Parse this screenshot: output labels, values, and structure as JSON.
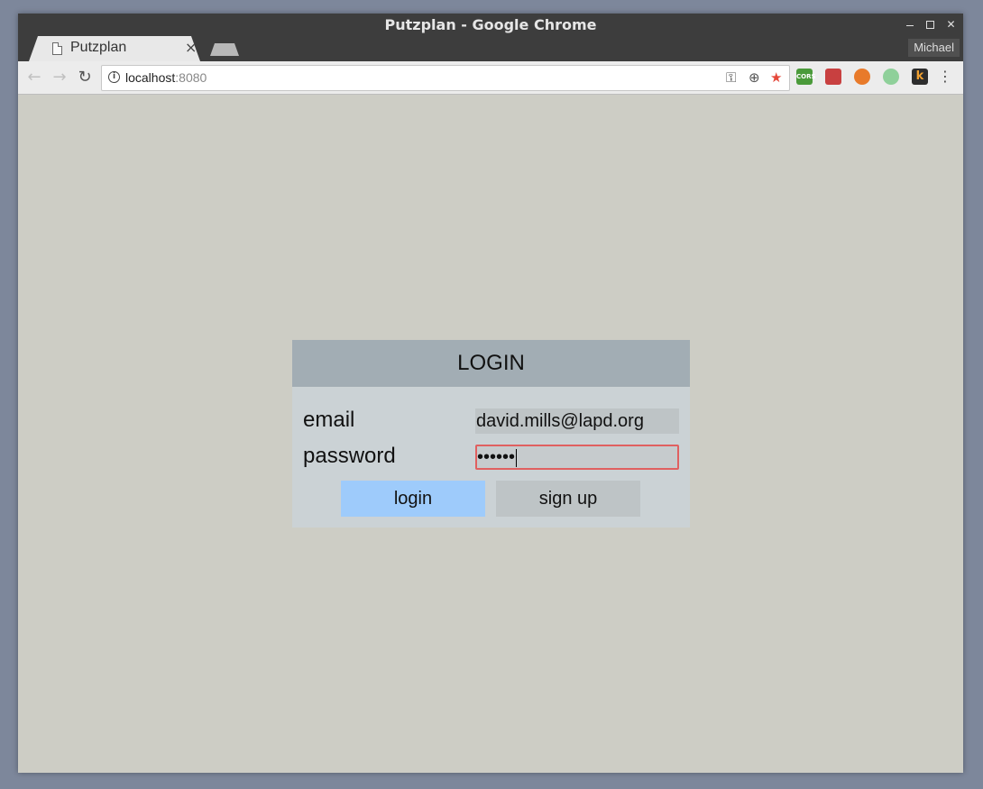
{
  "window": {
    "title": "Putzplan - Google Chrome",
    "profile_name": "Michael"
  },
  "tab": {
    "label": "Putzplan",
    "close_glyph": "×"
  },
  "toolbar": {
    "url_host": "localhost",
    "url_port": ":8080",
    "extensions": [
      {
        "name": "cors-extension-icon",
        "label": "CORS",
        "color": "#4a9a3a"
      },
      {
        "name": "bug-extension-icon",
        "label": "",
        "color": "#c84040"
      },
      {
        "name": "lifebuoy-extension-icon",
        "label": "",
        "color": "#e87a2a"
      },
      {
        "name": "circle-extension-icon",
        "label": "",
        "color": "#8fd09a"
      },
      {
        "name": "k-extension-icon",
        "label": "k",
        "color": "#2d2d2d"
      }
    ]
  },
  "login": {
    "heading": "LOGIN",
    "email_label": "email",
    "email_value": "david.mills@lapd.org",
    "password_label": "password",
    "password_masked": "••••••",
    "login_button": "login",
    "signup_button": "sign up"
  },
  "colors": {
    "page_bg": "#cdcdc5",
    "card_bg": "#cbd2d5",
    "header_bg": "#a2adb4",
    "login_button_bg": "#9ecbfb",
    "signup_button_bg": "#bec4c6",
    "invalid_border": "#e06060"
  }
}
